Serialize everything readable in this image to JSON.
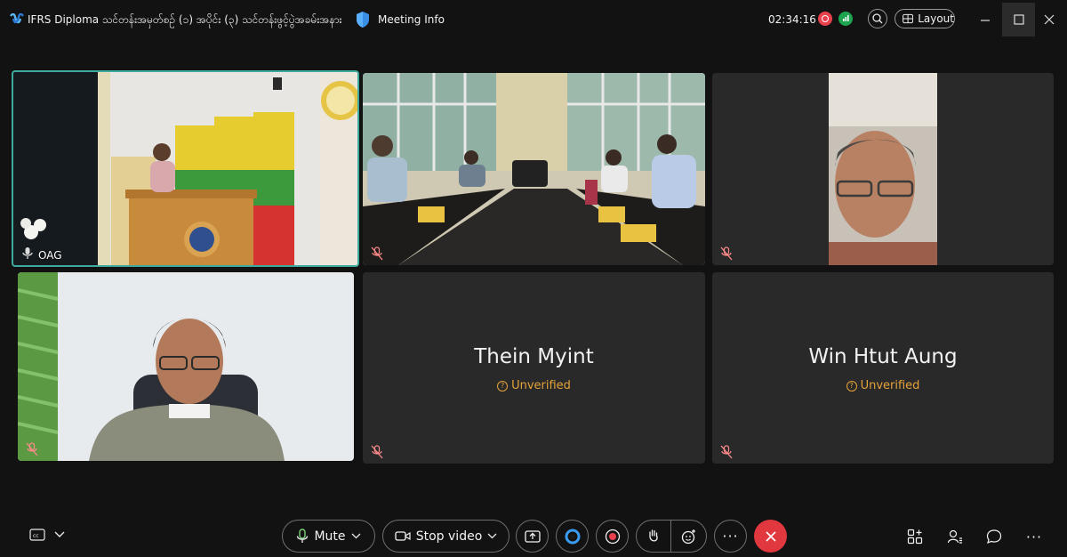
{
  "titlebar": {
    "meeting_title": "IFRS Diploma သင်တန်းအမှတ်စဉ် (၁) အပိုင်း (၃) သင်တန်းဖွင့်ပွဲအခမ်းအနား",
    "meeting_info_label": "Meeting Info",
    "timer": "02:34:16",
    "layout_label": "Layout"
  },
  "tiles": [
    {
      "name": "OAG",
      "active": true,
      "muted": true
    },
    {
      "name": "",
      "muted": true
    },
    {
      "name": "",
      "muted": true
    },
    {
      "name": "",
      "muted": true
    },
    {
      "name": "Thein Myint",
      "status": "Unverified",
      "muted": true
    },
    {
      "name": "Win Htut Aung",
      "status": "Unverified",
      "muted": true
    }
  ],
  "toolbar": {
    "mute_label": "Mute",
    "stop_video_label": "Stop video"
  },
  "colors": {
    "background": "#121212",
    "tile": "#292929",
    "active_border": "#3ea99f",
    "end_call": "#e0383e",
    "unverified": "#e5a23a",
    "recording": "#e8404d"
  }
}
